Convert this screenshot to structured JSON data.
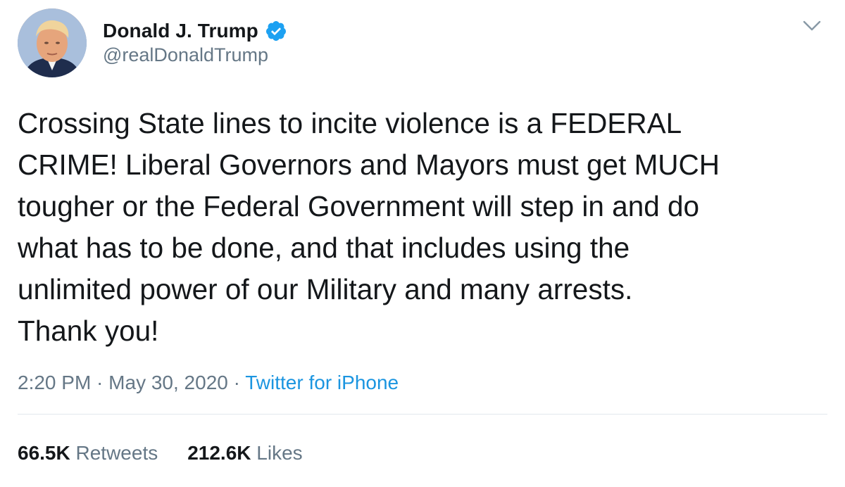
{
  "tweet": {
    "author": {
      "display_name": "Donald J. Trump",
      "handle": "@realDonaldTrump",
      "verified": true,
      "verified_icon": "verified-badge-icon"
    },
    "text": "Crossing State lines to incite violence is a FEDERAL\nCRIME! Liberal Governors and Mayors must get MUCH\ntougher or the Federal Government will step in and do\nwhat has to be done, and that includes using the\nunlimited power of our Military and many arrests.\nThank you!",
    "time": "2:20 PM",
    "separator": " · ",
    "date": "May 30, 2020",
    "source": "Twitter for iPhone",
    "retweets": {
      "count": "66.5K",
      "label": "Retweets"
    },
    "likes": {
      "count": "212.6K",
      "label": "Likes"
    }
  },
  "colors": {
    "text": "#14171a",
    "secondary": "#657786",
    "link": "#1b95e0",
    "verified": "#1da1f2",
    "divider": "#e1e8ed"
  }
}
